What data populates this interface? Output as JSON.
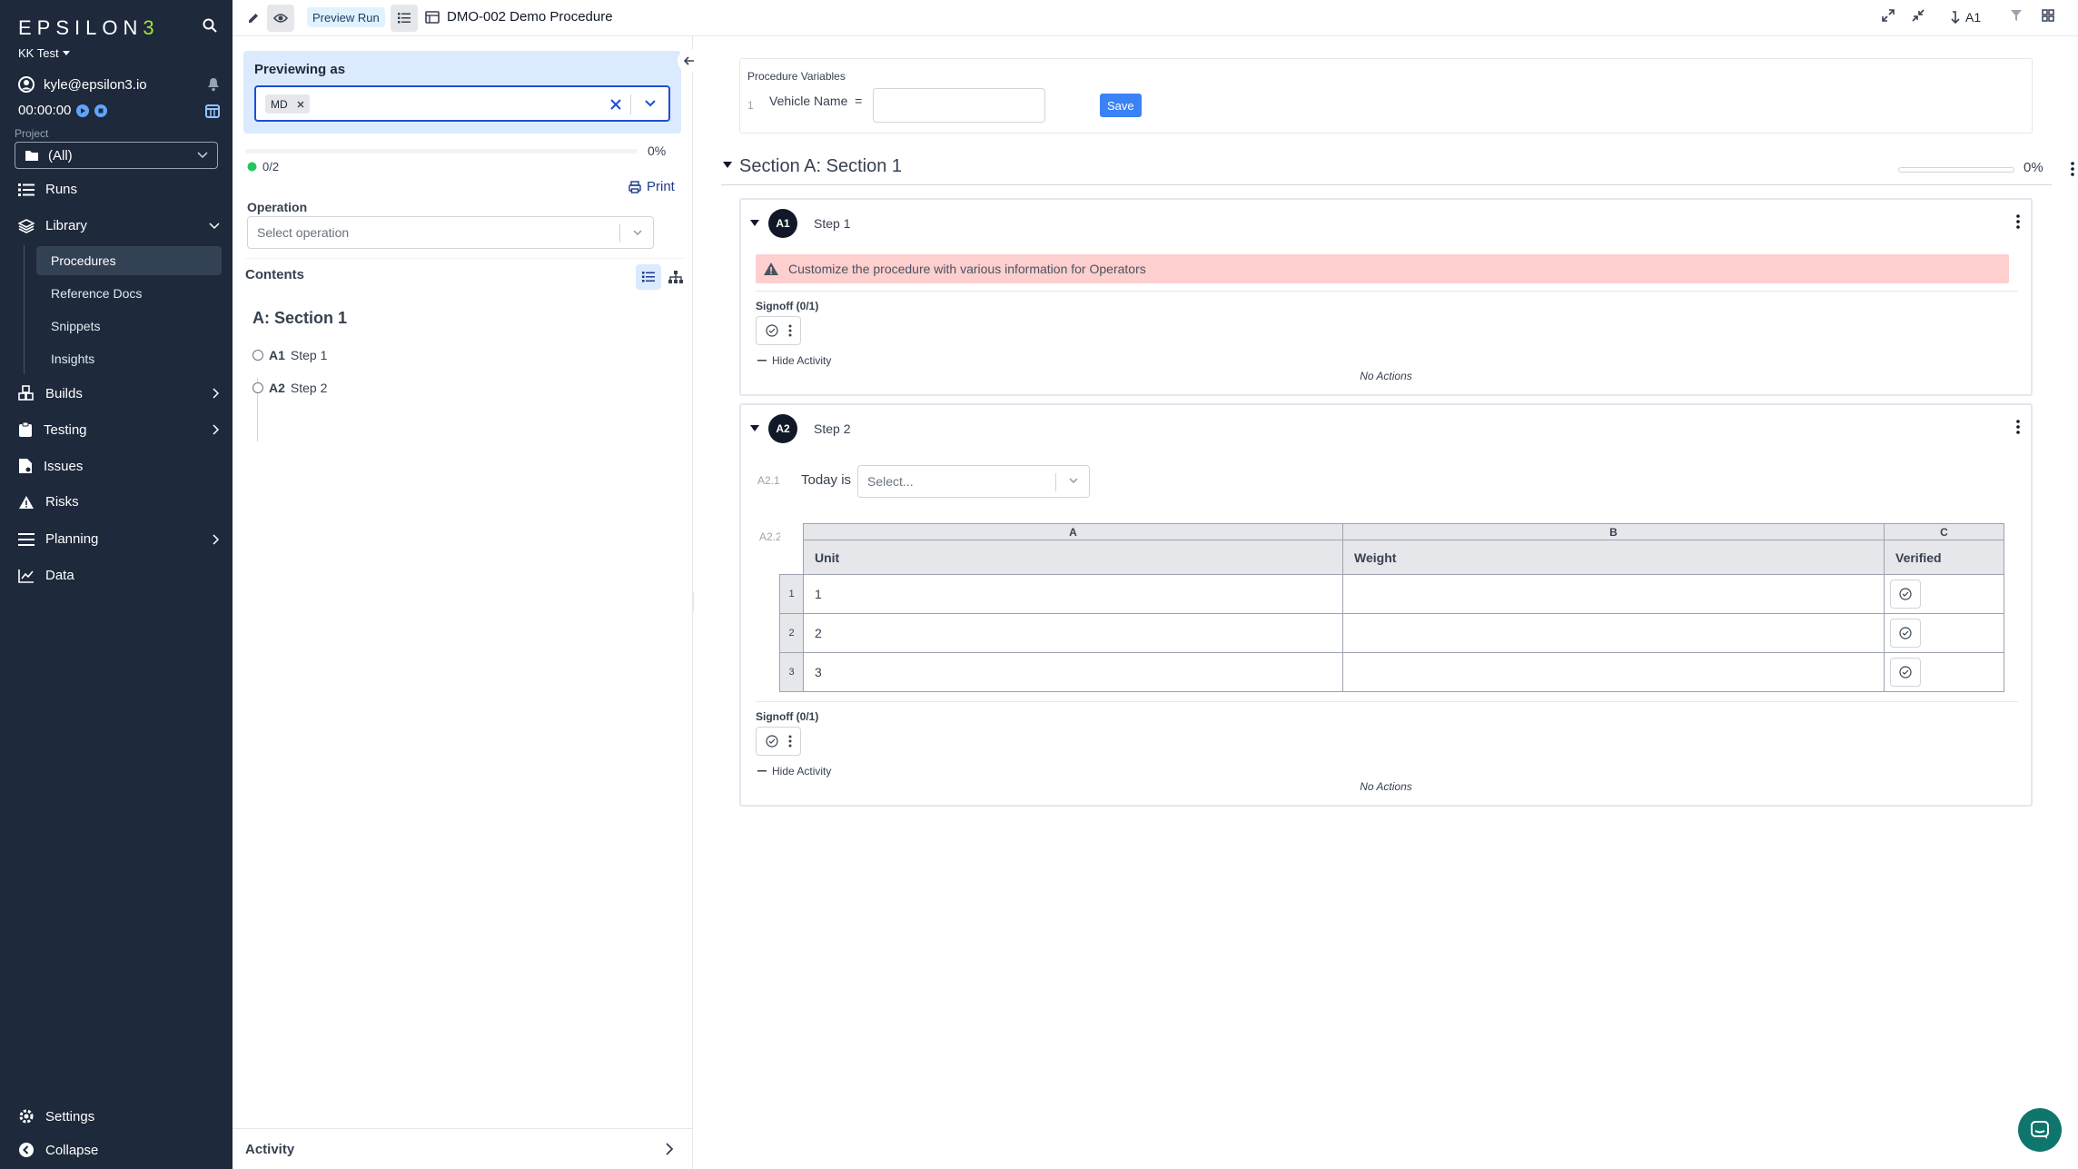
{
  "sidebar": {
    "logo": "EPSILON",
    "logo_end": "3",
    "team": "KK Test",
    "user": "kyle@epsilon3.io",
    "timer": "00:00:00",
    "project_label": "Project",
    "project_value": "(All)",
    "nav": [
      {
        "label": "Runs",
        "icon": "runs-icon"
      },
      {
        "label": "Library",
        "icon": "library-icon"
      },
      {
        "label": "Builds",
        "icon": "builds-icon"
      },
      {
        "label": "Testing",
        "icon": "testing-icon"
      },
      {
        "label": "Issues",
        "icon": "issues-icon"
      },
      {
        "label": "Risks",
        "icon": "risks-icon"
      },
      {
        "label": "Planning",
        "icon": "planning-icon"
      },
      {
        "label": "Data",
        "icon": "data-icon"
      }
    ],
    "library_items": [
      "Procedures",
      "Reference Docs",
      "Snippets",
      "Insights"
    ],
    "settings": "Settings",
    "collapse": "Collapse"
  },
  "topbar": {
    "preview_badge": "Preview Run",
    "procedure_title": "DMO-002 Demo Procedure",
    "step_jump": "A1"
  },
  "panel": {
    "previewing_as": "Previewing as",
    "role_chip": "MD",
    "progress_pct": "0%",
    "progress_count": "0/2",
    "print": "Print",
    "operation_label": "Operation",
    "operation_placeholder": "Select operation",
    "contents": "Contents",
    "toc_section": "A: Section 1",
    "toc_items": [
      {
        "id": "A1",
        "label": "Step 1"
      },
      {
        "id": "A2",
        "label": "Step 2"
      }
    ],
    "activity": "Activity"
  },
  "main": {
    "variables_title": "Procedure Variables",
    "variable_index": "1",
    "variable_name": "Vehicle Name",
    "variable_eq": "=",
    "variable_value": "",
    "save": "Save",
    "section_title": "Section A: Section 1",
    "section_pct": "0%",
    "steps": [
      {
        "badge": "A1",
        "name": "Step 1",
        "warning": "Customize the procedure with various information for Operators",
        "signoff": "Signoff (0/1)",
        "hide_activity": "Hide Activity",
        "no_actions": "No Actions"
      },
      {
        "badge": "A2",
        "name": "Step 2",
        "field1_idx": "A2.1",
        "field1_label": "Today is",
        "field1_placeholder": "Select...",
        "field2_idx": "A2.2",
        "table": {
          "letters": [
            "A",
            "B",
            "C"
          ],
          "headers": [
            "Unit",
            "Weight",
            "Verified"
          ],
          "rows": [
            {
              "num": "1",
              "unit": "1",
              "weight": ""
            },
            {
              "num": "2",
              "unit": "2",
              "weight": ""
            },
            {
              "num": "3",
              "unit": "3",
              "weight": ""
            }
          ]
        },
        "signoff": "Signoff (0/1)",
        "hide_activity": "Hide Activity",
        "no_actions": "No Actions"
      }
    ]
  }
}
